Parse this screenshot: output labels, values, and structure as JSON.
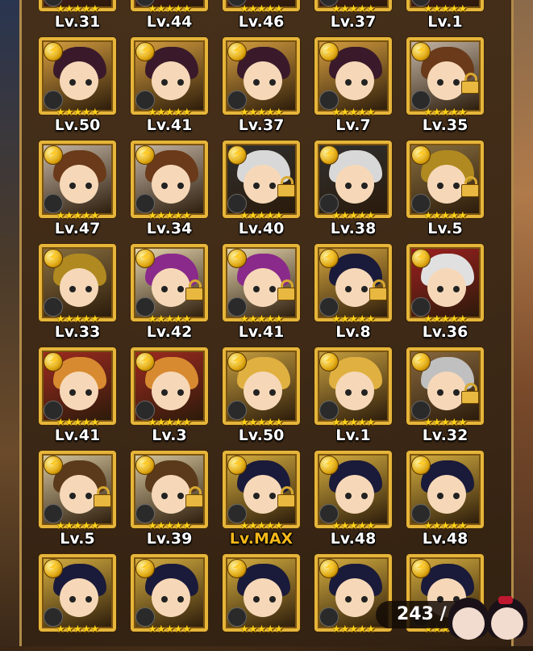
{
  "colors": {
    "frame_gold": "#e6b53a",
    "star_yellow": "#ffd21a",
    "level_white": "#ffffff",
    "level_max": "#f5b81a"
  },
  "star_glyph": "★★★★★",
  "rows": [
    {
      "cards": [
        {
          "level": "Lv.31",
          "hair": "#3a2a1a",
          "bg": "#6a2030",
          "locked": false
        },
        {
          "level": "Lv.44",
          "hair": "#3a2a1a",
          "bg": "#6a2030",
          "locked": false
        },
        {
          "level": "Lv.46",
          "hair": "#3a2a1a",
          "bg": "#6a2030",
          "locked": false
        },
        {
          "level": "Lv.37",
          "hair": "#3a2a1a",
          "bg": "#6a2030",
          "locked": false
        },
        {
          "level": "Lv.1",
          "hair": "#3a2a1a",
          "bg": "#6a2030",
          "locked": false
        }
      ]
    },
    {
      "cards": [
        {
          "level": "Lv.50",
          "hair": "#3a1a2a",
          "bg": "#d8a040",
          "locked": false
        },
        {
          "level": "Lv.41",
          "hair": "#3a1a2a",
          "bg": "#d8a040",
          "locked": false
        },
        {
          "level": "Lv.37",
          "hair": "#3a1a2a",
          "bg": "#d8a040",
          "locked": false
        },
        {
          "level": "Lv.7",
          "hair": "#3a1a2a",
          "bg": "#d8a040",
          "locked": false
        },
        {
          "level": "Lv.35",
          "hair": "#6a3a1a",
          "bg": "#c8b8a8",
          "locked": true
        }
      ]
    },
    {
      "cards": [
        {
          "level": "Lv.47",
          "hair": "#6a3a1a",
          "bg": "#c8b8a8",
          "locked": false
        },
        {
          "level": "Lv.34",
          "hair": "#6a3a1a",
          "bg": "#c8b8a8",
          "locked": false
        },
        {
          "level": "Lv.40",
          "hair": "#d8d8d8",
          "bg": "#303030",
          "locked": true
        },
        {
          "level": "Lv.38",
          "hair": "#d8d8d8",
          "bg": "#303030",
          "locked": false
        },
        {
          "level": "Lv.5",
          "hair": "#b08a20",
          "bg": "#8a7040",
          "locked": true
        }
      ]
    },
    {
      "cards": [
        {
          "level": "Lv.33",
          "hair": "#b08a20",
          "bg": "#8a7040",
          "locked": false
        },
        {
          "level": "Lv.42",
          "hair": "#8a2a8a",
          "bg": "#e8d8b0",
          "locked": true
        },
        {
          "level": "Lv.41",
          "hair": "#8a2a8a",
          "bg": "#e8d8b0",
          "locked": true
        },
        {
          "level": "Lv.8",
          "hair": "#1a1a3a",
          "bg": "#d8a840",
          "locked": true
        },
        {
          "level": "Lv.36",
          "hair": "#e0e0e0",
          "bg": "#a02020",
          "locked": false
        }
      ]
    },
    {
      "cards": [
        {
          "level": "Lv.41",
          "hair": "#d88a30",
          "bg": "#a02a20",
          "locked": false
        },
        {
          "level": "Lv.3",
          "hair": "#d88a30",
          "bg": "#a02a20",
          "locked": false
        },
        {
          "level": "Lv.50",
          "hair": "#e0b040",
          "bg": "#c8a040",
          "locked": false
        },
        {
          "level": "Lv.1",
          "hair": "#e0b040",
          "bg": "#c8a040",
          "locked": false
        },
        {
          "level": "Lv.32",
          "hair": "#c0c0c0",
          "bg": "#8a6a40",
          "locked": true
        }
      ]
    },
    {
      "cards": [
        {
          "level": "Lv.5",
          "hair": "#5a3a1a",
          "bg": "#d8c8a0",
          "locked": true
        },
        {
          "level": "Lv.39",
          "hair": "#5a3a1a",
          "bg": "#d8c8a0",
          "locked": true
        },
        {
          "level": "Lv.MAX",
          "hair": "#1a1a3a",
          "bg": "#d8b040",
          "locked": true,
          "max": true
        },
        {
          "level": "Lv.48",
          "hair": "#1a1a3a",
          "bg": "#d8b040",
          "locked": false
        },
        {
          "level": "Lv.48",
          "hair": "#1a1a3a",
          "bg": "#d8b040",
          "locked": false
        }
      ]
    },
    {
      "cards": [
        {
          "level": "",
          "hair": "#1a1a3a",
          "bg": "#d8b040",
          "locked": false
        },
        {
          "level": "",
          "hair": "#1a1a3a",
          "bg": "#d8b040",
          "locked": false
        },
        {
          "level": "",
          "hair": "#1a1a3a",
          "bg": "#d8b040",
          "locked": false
        },
        {
          "level": "",
          "hair": "#1a1a3a",
          "bg": "#d8b040",
          "locked": false
        },
        {
          "level": "",
          "hair": "#1a1a3a",
          "bg": "#d8b040",
          "locked": false
        }
      ]
    }
  ],
  "counter": {
    "text": "243 /"
  }
}
